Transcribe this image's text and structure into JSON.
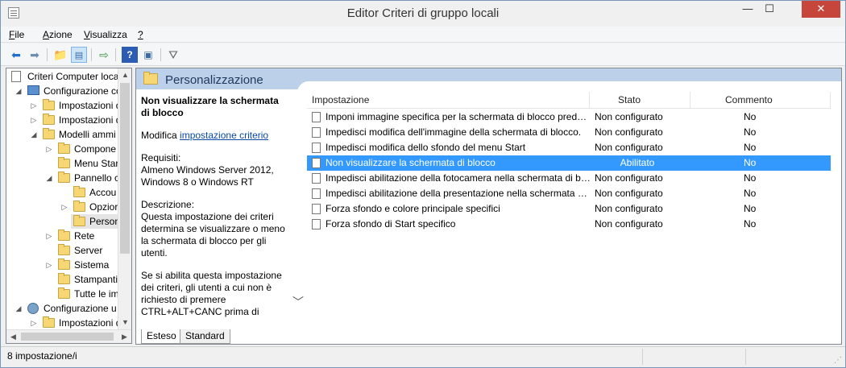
{
  "window": {
    "title": "Editor Criteri di gruppo locali"
  },
  "window_buttons": {
    "minimize": "—",
    "maximize": "☐",
    "close": "✕"
  },
  "menu": [
    {
      "key": "F",
      "rest": "ile"
    },
    {
      "key": "A",
      "rest": "zione"
    },
    {
      "key": "V",
      "rest": "isualizza"
    },
    {
      "key": "?",
      "rest": ""
    }
  ],
  "toolbar": {
    "icons": [
      "back-arrow-icon",
      "forward-arrow-icon",
      "up-folder-icon",
      "show-hide-tree-icon",
      "export-list-icon",
      "help-icon",
      "extended-view-icon",
      "filter-icon"
    ]
  },
  "tree": {
    "items": [
      {
        "label": "Criteri Computer loca",
        "icon": "doc-icon",
        "arrow": "",
        "indent": 0
      },
      {
        "label": "Configurazione co",
        "icon": "computer-icon",
        "arrow": "◢",
        "indent": 1
      },
      {
        "label": "Impostazioni d",
        "icon": "folder-icon",
        "arrow": "▷",
        "indent": 2
      },
      {
        "label": "Impostazioni d",
        "icon": "folder-icon",
        "arrow": "▷",
        "indent": 2
      },
      {
        "label": "Modelli ammi",
        "icon": "folder-icon",
        "arrow": "◢",
        "indent": 2
      },
      {
        "label": "Compone",
        "icon": "folder-icon",
        "arrow": "▷",
        "indent": 3
      },
      {
        "label": "Menu Star",
        "icon": "folder-icon",
        "arrow": "",
        "indent": 3
      },
      {
        "label": "Pannello c",
        "icon": "folder-icon",
        "arrow": "◢",
        "indent": 3
      },
      {
        "label": "Accou",
        "icon": "folder-icon",
        "arrow": "",
        "indent": 4
      },
      {
        "label": "Opzior",
        "icon": "folder-icon",
        "arrow": "▷",
        "indent": 4
      },
      {
        "label": "Person",
        "icon": "folder-icon",
        "arrow": "",
        "indent": 4,
        "selected": true
      },
      {
        "label": "Rete",
        "icon": "folder-icon",
        "arrow": "▷",
        "indent": 3
      },
      {
        "label": "Server",
        "icon": "folder-icon",
        "arrow": "",
        "indent": 3
      },
      {
        "label": "Sistema",
        "icon": "folder-icon",
        "arrow": "▷",
        "indent": 3
      },
      {
        "label": "Stampanti",
        "icon": "folder-icon",
        "arrow": "",
        "indent": 3
      },
      {
        "label": "Tutte le im",
        "icon": "folder-icon",
        "arrow": "",
        "indent": 3
      },
      {
        "label": "Configurazione u",
        "icon": "user-icon",
        "arrow": "◢",
        "indent": 1
      },
      {
        "label": "Impostazioni d",
        "icon": "folder-icon",
        "arrow": "▷",
        "indent": 2
      }
    ]
  },
  "content": {
    "header_title": "Personalizzazione",
    "description": {
      "title": "Non visualizzare la schermata di blocco",
      "edit_prefix": "Modifica ",
      "edit_link": "impostazione criterio",
      "req_label": "Requisiti:",
      "req_text": "Almeno Windows Server 2012, Windows 8 o Windows RT",
      "desc_label": "Descrizione:",
      "desc_text": "Questa impostazione dei criteri determina se visualizzare o meno la schermata di blocco per gli utenti.",
      "desc_text2": "Se si abilita questa impostazione dei criteri, gli utenti a cui non è richiesto di premere CTRL+ALT+CANC prima di"
    },
    "columns": {
      "setting": "Impostazione",
      "state": "Stato",
      "comment": "Commento"
    },
    "rows": [
      {
        "name": "Imponi immagine specifica per la schermata di blocco predefinita",
        "state": "Non configurato",
        "comment": "No"
      },
      {
        "name": "Impedisci modifica dell'immagine della schermata di blocco.",
        "state": "Non configurato",
        "comment": "No"
      },
      {
        "name": "Impedisci modifica dello sfondo del menu Start",
        "state": "Non configurato",
        "comment": "No"
      },
      {
        "name": "Non visualizzare la schermata di blocco",
        "state": "Abilitato",
        "comment": "No",
        "selected": true
      },
      {
        "name": "Impedisci abilitazione della fotocamera nella schermata di blocco",
        "state": "Non configurato",
        "comment": "No"
      },
      {
        "name": "Impedisci abilitazione della presentazione nella schermata di blocco",
        "state": "Non configurato",
        "comment": "No"
      },
      {
        "name": "Forza sfondo e colore principale specifici",
        "state": "Non configurato",
        "comment": "No"
      },
      {
        "name": "Forza sfondo di Start specifico",
        "state": "Non configurato",
        "comment": "No"
      }
    ],
    "tabs": [
      "Esteso",
      "Standard"
    ]
  },
  "status": {
    "text": "8 impostazione/i"
  },
  "colors": {
    "selection": "#3399ff",
    "header_band": "#bcd0ea",
    "link": "#0a49a5"
  }
}
